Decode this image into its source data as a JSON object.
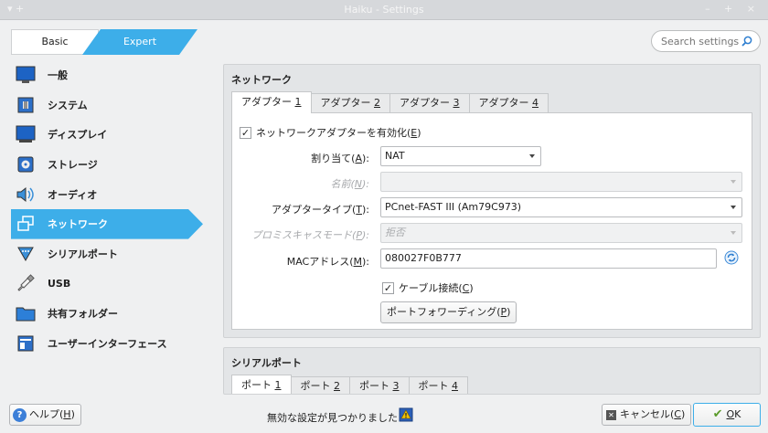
{
  "window": {
    "title": "Haiku - Settings",
    "left_controls": "▾  +",
    "right_controls": "– + ×"
  },
  "mode": {
    "basic": "Basic",
    "expert": "Expert"
  },
  "search": {
    "placeholder": "Search settings"
  },
  "sidebar": {
    "items": [
      {
        "label": "一般",
        "icon": "general-icon"
      },
      {
        "label": "システム",
        "icon": "system-icon"
      },
      {
        "label": "ディスプレイ",
        "icon": "display-icon"
      },
      {
        "label": "ストレージ",
        "icon": "storage-icon"
      },
      {
        "label": "オーディオ",
        "icon": "audio-icon"
      },
      {
        "label": "ネットワーク",
        "icon": "network-icon"
      },
      {
        "label": "シリアルポート",
        "icon": "serial-port-icon"
      },
      {
        "label": "USB",
        "icon": "usb-icon"
      },
      {
        "label": "共有フォルダー",
        "icon": "shared-folder-icon"
      },
      {
        "label": "ユーザーインターフェース",
        "icon": "user-interface-icon"
      }
    ],
    "selected": "ネットワーク"
  },
  "network": {
    "title": "ネットワーク",
    "tabs": [
      {
        "prefix": "アダプター ",
        "num": "1"
      },
      {
        "prefix": "アダプター ",
        "num": "2"
      },
      {
        "prefix": "アダプター ",
        "num": "3"
      },
      {
        "prefix": "アダプター ",
        "num": "4"
      }
    ],
    "enable": {
      "pre": "ネットワークアダプターを有効化(",
      "key": "E",
      "post": ")",
      "checked": true
    },
    "attached": {
      "label_pre": "割り当て(",
      "label_key": "A",
      "label_post": "):",
      "value": "NAT"
    },
    "name": {
      "label_pre": "名前(",
      "label_key": "N",
      "label_post": "):",
      "value": ""
    },
    "adapter_type": {
      "label_pre": "アダプタータイプ(",
      "label_key": "T",
      "label_post": "):",
      "value": "PCnet-FAST III (Am79C973)"
    },
    "promisc": {
      "label_pre": "プロミスキャスモード(",
      "label_key": "P",
      "label_post": "):",
      "value": "拒否"
    },
    "mac": {
      "label_pre": "MACアドレス(",
      "label_key": "M",
      "label_post": "):",
      "value": "080027F0B777"
    },
    "cable": {
      "pre": "ケーブル接続(",
      "key": "C",
      "post": ")",
      "checked": true
    },
    "port_forward": {
      "pre": "ポートフォワーディング(",
      "key": "P",
      "post": ")"
    }
  },
  "serial": {
    "title": "シリアルポート",
    "tabs": [
      {
        "prefix": "ポート ",
        "num": "1"
      },
      {
        "prefix": "ポート ",
        "num": "2"
      },
      {
        "prefix": "ポート ",
        "num": "3"
      },
      {
        "prefix": "ポート ",
        "num": "4"
      }
    ]
  },
  "bottom": {
    "help": {
      "pre": "ヘルプ(",
      "key": "H",
      "post": ")"
    },
    "warning": "無効な設定が見つかりました",
    "cancel": {
      "pre": "キャンセル(",
      "key": "C",
      "post": ")"
    },
    "ok": {
      "key": "O",
      "post": "K"
    }
  },
  "colors": {
    "accent": "#3daee9",
    "window_bg": "#eff0f1",
    "titlebar": "#d6d8db"
  }
}
